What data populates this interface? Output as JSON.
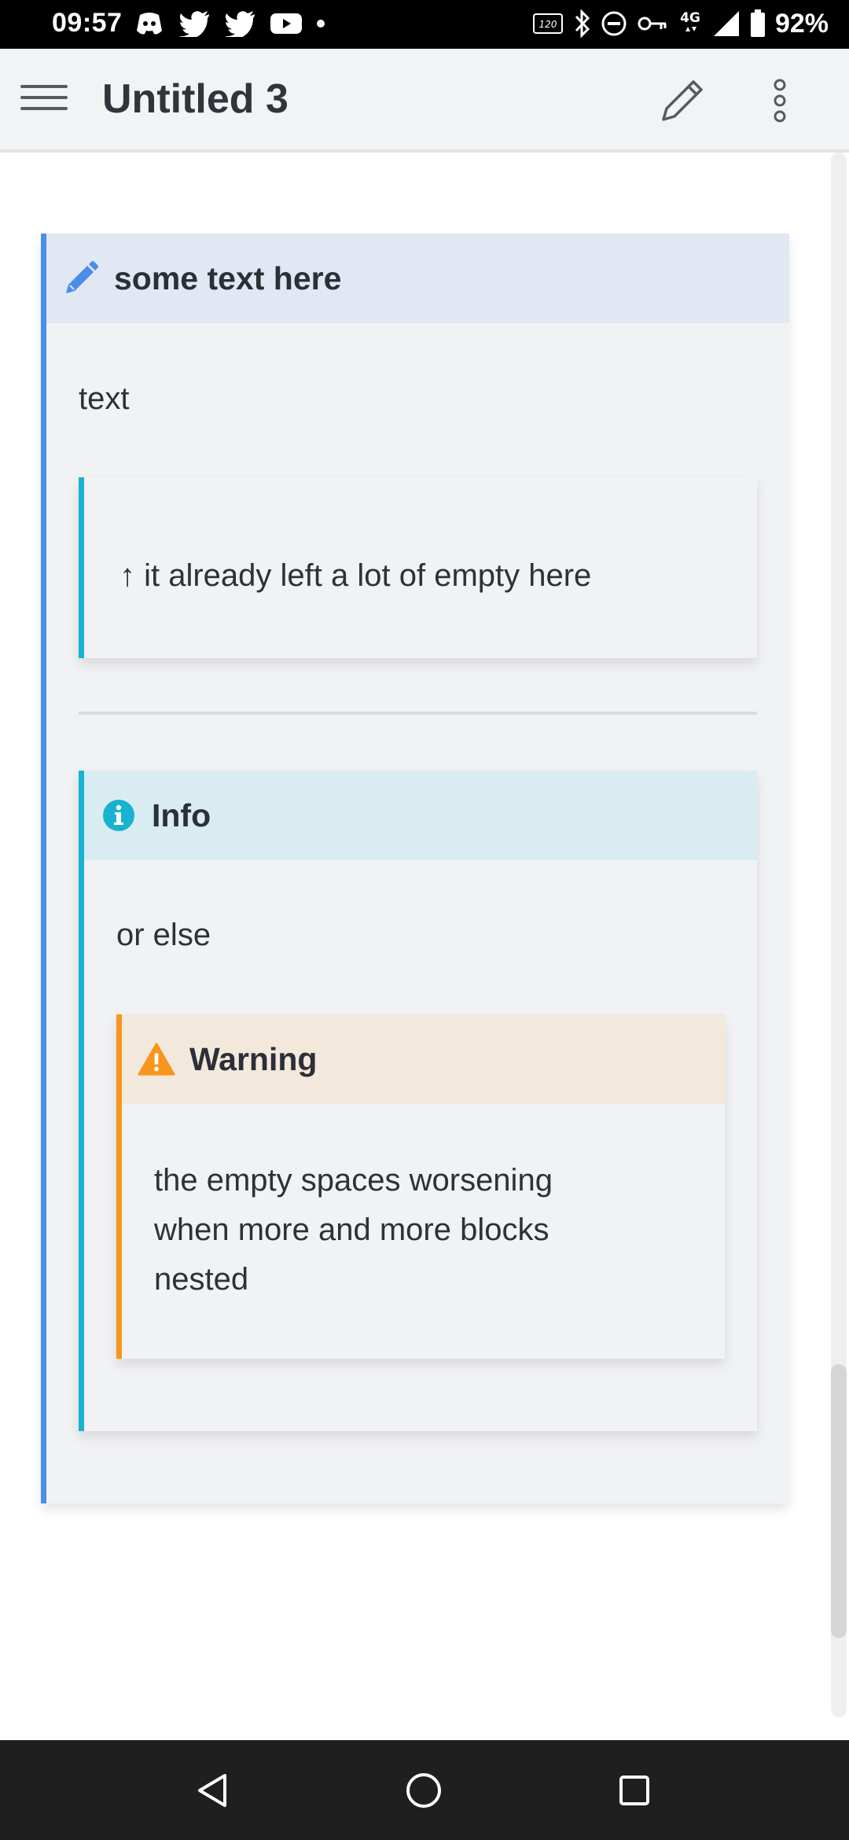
{
  "status_bar": {
    "time": "09:57",
    "battery": "92%",
    "left_icons": [
      "discord-icon",
      "twitter-icon",
      "twitter-icon",
      "youtube-icon",
      "dot-icon"
    ],
    "right_icons": [
      "120hz-icon",
      "bluetooth-icon",
      "dnd-icon",
      "vpn-key-icon",
      "4g-icon",
      "signal-icon",
      "battery-icon"
    ],
    "network": "4G"
  },
  "app_bar": {
    "title": "Untitled 3",
    "menu_icon": "hamburger-menu-icon",
    "edit_icon": "pencil-icon",
    "more_icon": "more-vert-icon"
  },
  "callout_main": {
    "title": "some text here",
    "icon": "pencil-icon",
    "accent": "#4a8ee8",
    "header_bg": "#e1e7f3",
    "text": "text"
  },
  "quote_block": {
    "text": "↑ it already left a lot of empty here",
    "accent": "#17b3d0"
  },
  "callout_info": {
    "title": "Info",
    "icon": "info-icon",
    "accent": "#17b3d0",
    "header_bg": "#d9ecf2",
    "text": "or else"
  },
  "callout_warning": {
    "title": "Warning",
    "icon": "warning-icon",
    "accent": "#f7961d",
    "header_bg": "#f3e8dc",
    "text_line1": "the empty spaces worsening",
    "text_line2": "when more and more blocks",
    "text_line3": "nested"
  },
  "nav_bar": {
    "back_icon": "back-triangle-icon",
    "home_icon": "home-circle-icon",
    "recents_icon": "recents-square-icon"
  }
}
